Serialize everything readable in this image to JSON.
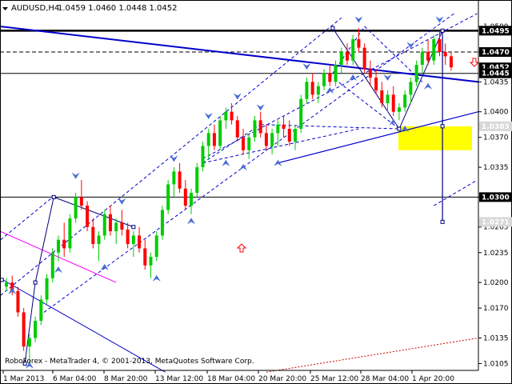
{
  "chart_data": {
    "type": "candlestick",
    "symbol": "AUDUSD,H4",
    "ohlc_text": "1.0459 1.0460 1.0448 1.0452",
    "copyright": "RoboForex - MetaTrader 4, © 2001-2013, MetaQuotes Software Corp.",
    "ylim": [
      1.0097,
      1.0515
    ],
    "y_ticks": [
      1.05,
      1.047,
      1.0435,
      1.04,
      1.037,
      1.0335,
      1.03,
      1.0265,
      1.0235,
      1.02,
      1.017,
      1.0135,
      1.0105
    ],
    "y_tick_labels": [
      "1.0500",
      "1.0470",
      "1.0435",
      "1.0400",
      "1.0370",
      "1.0335",
      "1.0300",
      "1.0265",
      "1.0235",
      "1.0200",
      "1.0170",
      "1.0135",
      "1.0105"
    ],
    "x_tick_labels": [
      "1 Mar 2013",
      "6 Mar 04:00",
      "8 Mar 20:00",
      "13 Mar 12:00",
      "18 Mar 04:00",
      "20 Mar 20:00",
      "25 Mar 12:00",
      "28 Mar 04:00",
      "1 Apr 20:00"
    ],
    "price_labels": [
      {
        "value": 1.0495,
        "text": "1.0495",
        "style": "black"
      },
      {
        "value": 1.047,
        "text": "1.0470",
        "style": "black"
      },
      {
        "value": 1.0452,
        "text": "1.0452",
        "style": "black"
      },
      {
        "value": 1.0445,
        "text": "1.0445",
        "style": "black"
      },
      {
        "value": 1.0383,
        "text": "1.0383",
        "style": "light"
      },
      {
        "value": 1.03,
        "text": "1.0300",
        "style": "black"
      },
      {
        "value": 1.0271,
        "text": "1.0271",
        "style": "light"
      }
    ],
    "horizontal_levels": [
      {
        "value": 1.0495,
        "style": "thick"
      },
      {
        "value": 1.047,
        "style": "dashed"
      },
      {
        "value": 1.0445,
        "style": "thin"
      },
      {
        "value": 1.03,
        "style": "thin"
      }
    ],
    "colors": {
      "bull_candle": "#00cc00",
      "bear_candle": "#ff0000",
      "trendline": "#0000cc",
      "fractal_arrow": "#4a6cd4",
      "target_zone": "#ffff00",
      "magenta_line": "#ff00ff",
      "red_dotted": "#cc0000"
    },
    "candles": [
      [
        1.0195,
        1.0205,
        1.019,
        1.02
      ],
      [
        1.02,
        1.0208,
        1.0185,
        1.019
      ],
      [
        1.019,
        1.0195,
        1.016,
        1.0165
      ],
      [
        1.0165,
        1.017,
        1.012,
        1.0125
      ],
      [
        1.0125,
        1.014,
        1.0105,
        1.0135
      ],
      [
        1.0135,
        1.016,
        1.013,
        1.0155
      ],
      [
        1.0155,
        1.0185,
        1.015,
        1.018
      ],
      [
        1.018,
        1.021,
        1.0175,
        1.0205
      ],
      [
        1.0205,
        1.024,
        1.02,
        1.0235
      ],
      [
        1.0235,
        1.0255,
        1.0225,
        1.025
      ],
      [
        1.025,
        1.027,
        1.023,
        1.024
      ],
      [
        1.024,
        1.028,
        1.0235,
        1.0275
      ],
      [
        1.0275,
        1.0305,
        1.027,
        1.03
      ],
      [
        1.03,
        1.032,
        1.0285,
        1.029
      ],
      [
        1.029,
        1.0295,
        1.026,
        1.0265
      ],
      [
        1.0265,
        1.0275,
        1.024,
        1.0245
      ],
      [
        1.0245,
        1.026,
        1.0225,
        1.0255
      ],
      [
        1.0255,
        1.0285,
        1.025,
        1.028
      ],
      [
        1.028,
        1.029,
        1.0255,
        1.026
      ],
      [
        1.026,
        1.0275,
        1.0245,
        1.027
      ],
      [
        1.027,
        1.0285,
        1.0255,
        1.0262
      ],
      [
        1.0262,
        1.027,
        1.024,
        1.0245
      ],
      [
        1.0245,
        1.026,
        1.023,
        1.0255
      ],
      [
        1.0255,
        1.0265,
        1.0235,
        1.024
      ],
      [
        1.024,
        1.025,
        1.0215,
        1.022
      ],
      [
        1.022,
        1.0235,
        1.0205,
        1.023
      ],
      [
        1.023,
        1.026,
        1.0225,
        1.0255
      ],
      [
        1.0255,
        1.029,
        1.025,
        1.0285
      ],
      [
        1.0285,
        1.032,
        1.028,
        1.0315
      ],
      [
        1.0315,
        1.0335,
        1.03,
        1.033
      ],
      [
        1.033,
        1.034,
        1.0305,
        1.031
      ],
      [
        1.031,
        1.032,
        1.0285,
        1.029
      ],
      [
        1.029,
        1.031,
        1.028,
        1.0305
      ],
      [
        1.0305,
        1.034,
        1.03,
        1.0335
      ],
      [
        1.0335,
        1.0365,
        1.033,
        1.036
      ],
      [
        1.036,
        1.038,
        1.0345,
        1.0375
      ],
      [
        1.0375,
        1.0385,
        1.0355,
        1.036
      ],
      [
        1.036,
        1.0395,
        1.0355,
        1.039
      ],
      [
        1.039,
        1.0405,
        1.038,
        1.04
      ],
      [
        1.04,
        1.041,
        1.0385,
        1.039
      ],
      [
        1.039,
        1.0395,
        1.0365,
        1.037
      ],
      [
        1.037,
        1.038,
        1.035,
        1.0355
      ],
      [
        1.0355,
        1.0375,
        1.0345,
        1.037
      ],
      [
        1.037,
        1.0395,
        1.0365,
        1.039
      ],
      [
        1.039,
        1.04,
        1.037,
        1.0375
      ],
      [
        1.0375,
        1.0385,
        1.0355,
        1.036
      ],
      [
        1.036,
        1.038,
        1.035,
        1.0375
      ],
      [
        1.0375,
        1.039,
        1.036,
        1.0385
      ],
      [
        1.0385,
        1.0395,
        1.037,
        1.038
      ],
      [
        1.038,
        1.039,
        1.036,
        1.0365
      ],
      [
        1.0365,
        1.0385,
        1.0355,
        1.038
      ],
      [
        1.038,
        1.042,
        1.0375,
        1.0415
      ],
      [
        1.0415,
        1.044,
        1.041,
        1.0435
      ],
      [
        1.0435,
        1.0445,
        1.0415,
        1.042
      ],
      [
        1.042,
        1.0435,
        1.041,
        1.043
      ],
      [
        1.043,
        1.045,
        1.0425,
        1.0445
      ],
      [
        1.0445,
        1.0455,
        1.043,
        1.0435
      ],
      [
        1.0435,
        1.046,
        1.043,
        1.0455
      ],
      [
        1.0455,
        1.0475,
        1.0445,
        1.047
      ],
      [
        1.047,
        1.048,
        1.0455,
        1.046
      ],
      [
        1.046,
        1.049,
        1.0455,
        1.0485
      ],
      [
        1.0485,
        1.0498,
        1.047,
        1.0475
      ],
      [
        1.0475,
        1.048,
        1.0445,
        1.045
      ],
      [
        1.045,
        1.046,
        1.043,
        1.044
      ],
      [
        1.044,
        1.045,
        1.042,
        1.0425
      ],
      [
        1.0425,
        1.0435,
        1.0405,
        1.041
      ],
      [
        1.041,
        1.0425,
        1.04,
        1.042
      ],
      [
        1.042,
        1.043,
        1.0395,
        1.04
      ],
      [
        1.04,
        1.041,
        1.039,
        1.0405
      ],
      [
        1.0405,
        1.0425,
        1.04,
        1.042
      ],
      [
        1.042,
        1.044,
        1.041,
        1.0435
      ],
      [
        1.0435,
        1.046,
        1.043,
        1.0455
      ],
      [
        1.0455,
        1.0475,
        1.0445,
        1.047
      ],
      [
        1.047,
        1.0485,
        1.0455,
        1.046
      ],
      [
        1.046,
        1.049,
        1.0455,
        1.0485
      ],
      [
        1.0485,
        1.0495,
        1.0465,
        1.047
      ],
      [
        1.047,
        1.048,
        1.0455,
        1.0465
      ],
      [
        1.0465,
        1.047,
        1.0448,
        1.0452
      ]
    ],
    "arrows_up": [
      [
        1,
        1.019
      ],
      [
        4,
        1.0103
      ],
      [
        9,
        1.0215
      ],
      [
        17,
        1.0218
      ],
      [
        26,
        1.0205
      ],
      [
        32,
        1.0272
      ],
      [
        38,
        1.034
      ],
      [
        41,
        1.0335
      ],
      [
        47,
        1.034
      ],
      [
        56,
        1.0425
      ],
      [
        60,
        1.044
      ],
      [
        67,
        1.0388
      ],
      [
        69,
        1.038
      ],
      [
        73,
        1.043
      ]
    ],
    "arrows_down": [
      [
        12,
        1.0325
      ],
      [
        20,
        1.0295
      ],
      [
        29,
        1.0345
      ],
      [
        35,
        1.0395
      ],
      [
        40,
        1.0418
      ],
      [
        44,
        1.0405
      ],
      [
        52,
        1.0453
      ],
      [
        61,
        1.0508
      ],
      [
        66,
        1.044
      ],
      [
        70,
        1.0478
      ],
      [
        75,
        1.0508
      ]
    ]
  }
}
